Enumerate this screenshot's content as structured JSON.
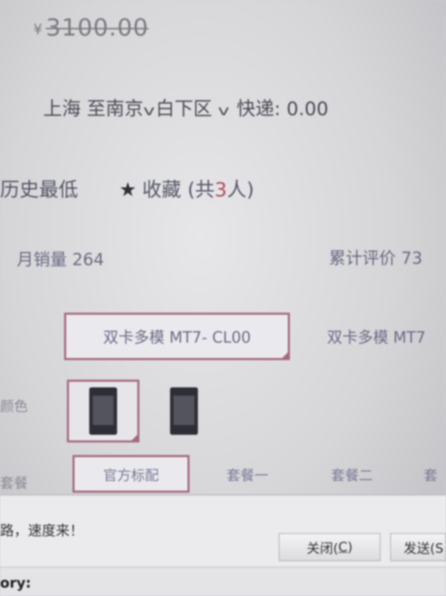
{
  "price": {
    "currency": "¥",
    "original": "3100.00"
  },
  "shipping": {
    "from": "上海",
    "to_label": "至",
    "city": "南京",
    "district": "白下区",
    "fee_text": "快递: 0.00"
  },
  "price_history": {
    "label": "历史最低"
  },
  "favorite": {
    "label": "收藏",
    "count_prefix": "(共",
    "count": "3",
    "count_suffix": "人)"
  },
  "stats": {
    "monthly_sales": "月销量 264",
    "reviews": "累计评价 73"
  },
  "variants": [
    {
      "label": "双卡多模 MT7- CL00",
      "selected": true
    },
    {
      "label": "双卡多模 MT7",
      "selected": false
    }
  ],
  "color": {
    "label": "颜色"
  },
  "package": {
    "label": "套餐",
    "options": [
      {
        "label": "官方标配",
        "selected": true
      },
      {
        "label": "套餐一",
        "selected": false
      },
      {
        "label": "套餐二",
        "selected": false
      },
      {
        "label": "套",
        "selected": false
      }
    ]
  },
  "dialog": {
    "message": "路，速度来！",
    "close_button": "关闭(C)",
    "close_text": "关闭(",
    "close_key": "C",
    "close_end": ")",
    "send_button": "发送(S"
  },
  "footer": {
    "text": "ory:"
  },
  "colors": {
    "selected_border": "#a56a7e",
    "background": "#d6d6d9"
  }
}
